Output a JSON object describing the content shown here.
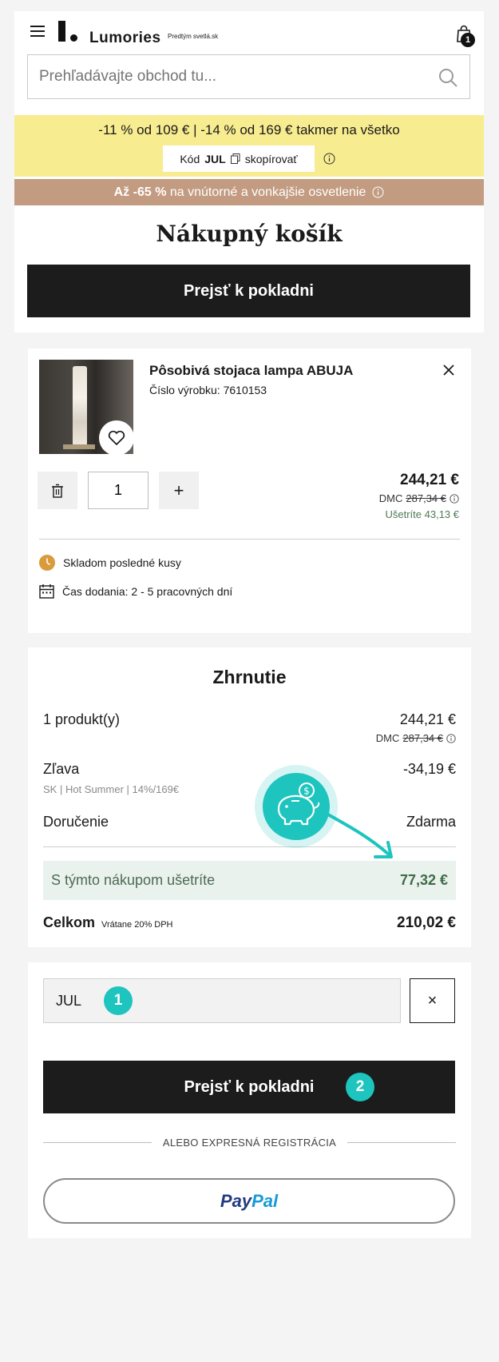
{
  "header": {
    "logo_text": "Lumories",
    "tagline": "Predtým svetlá.sk",
    "cart_count": "1"
  },
  "search": {
    "placeholder": "Prehľadávajte obchod tu..."
  },
  "promo_bar": {
    "offer_text": "-11 % od 109 € | -14 % od 169 € takmer na všetko",
    "code_label": "Kód",
    "code_value": "JUL",
    "copy_label": "skopírovať"
  },
  "promo_bar2": {
    "text_bold": "Až -65 %",
    "text_rest": "na vnútorné a vonkajšie osvetlenie"
  },
  "cart": {
    "title": "Nákupný košík",
    "checkout_label": "Prejsť k pokladni"
  },
  "product": {
    "name": "Pôsobivá stojaca lampa ABUJA",
    "sku": "Číslo výrobku: 7610153",
    "quantity": "1",
    "plus": "+",
    "price": "244,21 €",
    "dmc_label": "DMC",
    "dmc_price": "287,34 €",
    "save_text": "Ušetríte 43,13 €",
    "stock_text": "Skladom posledné kusy",
    "delivery_text": "Čas dodania: 2 - 5 pracovných dní"
  },
  "summary": {
    "title": "Zhrnutie",
    "products_label": "1 produkt(y)",
    "products_value": "244,21 €",
    "dmc_label": "DMC",
    "dmc_value": "287,34 €",
    "discount_label": "Zľava",
    "discount_detail": "SK | Hot Summer | 14%/169€",
    "discount_value": "-34,19 €",
    "delivery_label": "Doručenie",
    "delivery_value": "Zdarma",
    "savings_label": "S týmto nákupom ušetríte",
    "savings_value": "77,32 €",
    "total_label": "Celkom",
    "total_vat": "Vrátane 20% DPH",
    "total_value": "210,02 €"
  },
  "coupon": {
    "value": "JUL",
    "step1": "1",
    "clear_symbol": "×"
  },
  "checkout": {
    "label": "Prejsť k pokladni",
    "step2": "2",
    "or_text": "ALEBO EXPRESNÁ REGISTRÁCIA",
    "paypal_part1": "Pay",
    "paypal_part2": "Pal"
  },
  "colors": {
    "accent_teal": "#1ec4be",
    "promo_yellow": "#f8ec90",
    "promo_brown": "#c29b81",
    "savings_green": "#3f6b47"
  }
}
